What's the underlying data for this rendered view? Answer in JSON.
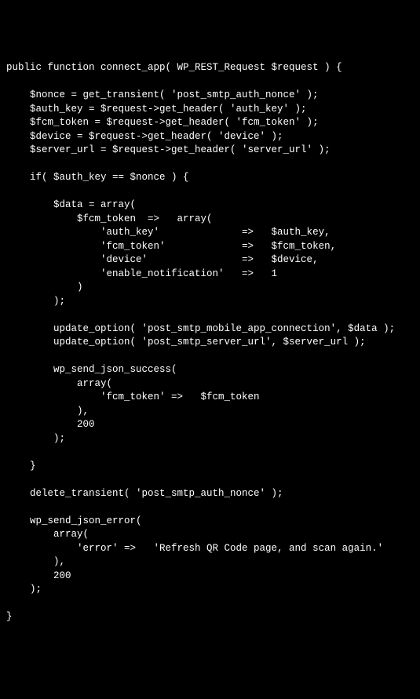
{
  "code": {
    "l1": "public function connect_app( WP_REST_Request $request ) {",
    "l2": "",
    "l3": "    $nonce = get_transient( 'post_smtp_auth_nonce' );",
    "l4": "    $auth_key = $request->get_header( 'auth_key' );",
    "l5": "    $fcm_token = $request->get_header( 'fcm_token' );",
    "l6": "    $device = $request->get_header( 'device' );",
    "l7": "    $server_url = $request->get_header( 'server_url' );",
    "l8": "",
    "l9": "    if( $auth_key == $nonce ) {",
    "l10": "",
    "l11": "        $data = array(",
    "l12": "            $fcm_token  =>   array(",
    "l13": "                'auth_key'              =>   $auth_key,",
    "l14": "                'fcm_token'             =>   $fcm_token,",
    "l15": "                'device'                =>   $device,",
    "l16": "                'enable_notification'   =>   1",
    "l17": "            )",
    "l18": "        );",
    "l19": "",
    "l20": "        update_option( 'post_smtp_mobile_app_connection', $data );",
    "l21": "        update_option( 'post_smtp_server_url', $server_url );",
    "l22": "",
    "l23": "        wp_send_json_success(",
    "l24": "            array(",
    "l25": "                'fcm_token' =>   $fcm_token",
    "l26": "            ),",
    "l27": "            200",
    "l28": "        );",
    "l29": "",
    "l30": "    }",
    "l31": "",
    "l32": "    delete_transient( 'post_smtp_auth_nonce' );",
    "l33": "",
    "l34": "    wp_send_json_error(",
    "l35": "        array(",
    "l36": "            'error' =>   'Refresh QR Code page, and scan again.'",
    "l37": "        ),",
    "l38": "        200",
    "l39": "    );",
    "l40": "",
    "l41": "}"
  }
}
